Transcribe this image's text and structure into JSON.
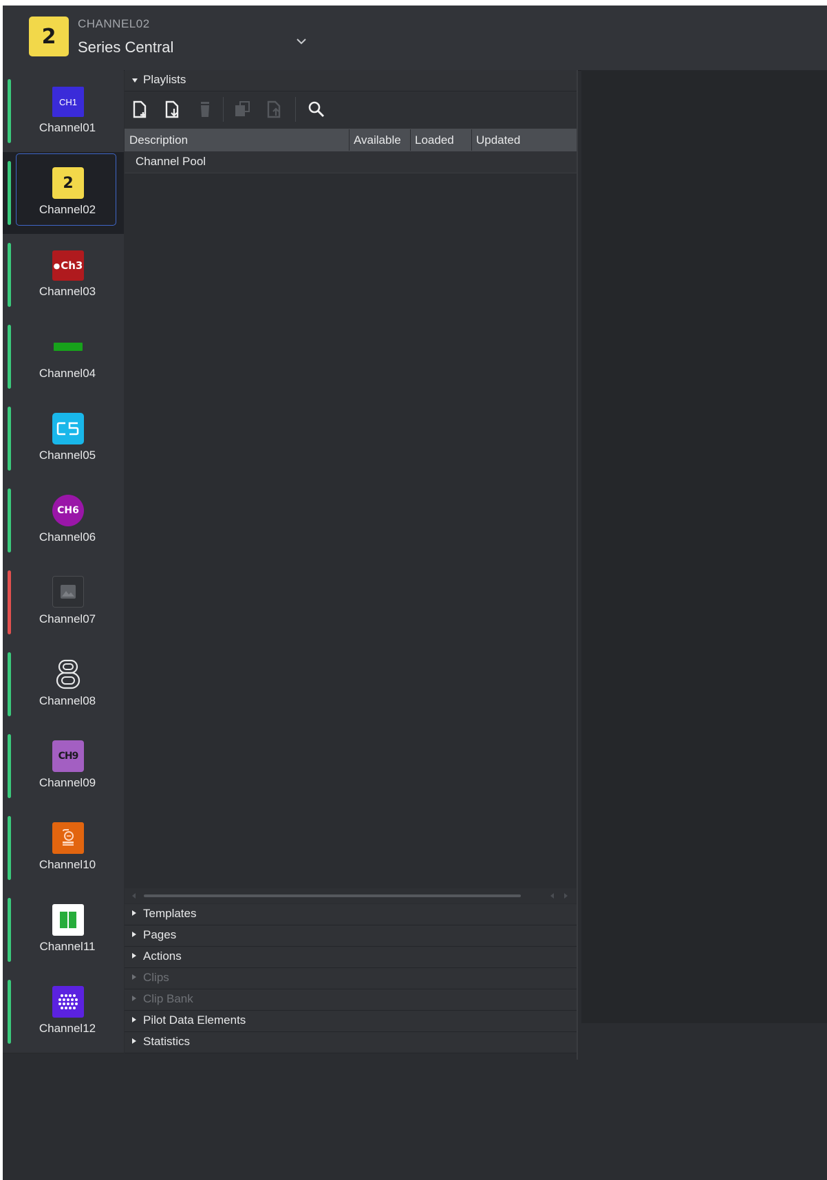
{
  "header": {
    "logo_text": "2",
    "channel_code": "CHANNEL02",
    "title": "Series Central",
    "dropdown_icon": "chevron-down-icon"
  },
  "sidebar": {
    "channels": [
      {
        "label": "Channel01",
        "logo_text": "CH1",
        "status": "green"
      },
      {
        "label": "Channel02",
        "logo_text": "2",
        "status": "green",
        "selected": true
      },
      {
        "label": "Channel03",
        "logo_text": "Ch3",
        "status": "green"
      },
      {
        "label": "Channel04",
        "logo_text": "",
        "status": "green"
      },
      {
        "label": "Channel05",
        "logo_text": "C5",
        "status": "green"
      },
      {
        "label": "Channel06",
        "logo_text": "CH6",
        "status": "green"
      },
      {
        "label": "Channel07",
        "logo_text": "",
        "status": "red"
      },
      {
        "label": "Channel08",
        "logo_text": "",
        "status": "green"
      },
      {
        "label": "Channel09",
        "logo_text": "CH9",
        "status": "green"
      },
      {
        "label": "Channel10",
        "logo_text": "",
        "status": "green"
      },
      {
        "label": "Channel11",
        "logo_text": "",
        "status": "green"
      },
      {
        "label": "Channel12",
        "logo_text": "",
        "status": "green"
      }
    ]
  },
  "playlists": {
    "section_label": "Playlists",
    "toolbar": [
      "new-playlist-icon",
      "import-playlist-icon",
      "delete-icon",
      "copy-icon",
      "export-icon",
      "search-icon"
    ],
    "columns": {
      "description": "Description",
      "available": "Available",
      "loaded": "Loaded",
      "updated": "Updated"
    },
    "rows": [
      {
        "description": "Channel Pool"
      }
    ]
  },
  "sections": [
    {
      "label": "Templates",
      "enabled": true
    },
    {
      "label": "Pages",
      "enabled": true
    },
    {
      "label": "Actions",
      "enabled": true
    },
    {
      "label": "Clips",
      "enabled": false
    },
    {
      "label": "Clip Bank",
      "enabled": false
    },
    {
      "label": "Pilot Data Elements",
      "enabled": true
    },
    {
      "label": "Statistics",
      "enabled": true
    }
  ],
  "colors": {
    "status_green": "#3bc97c",
    "status_red": "#e3514f",
    "selection_border": "#3f67c8",
    "channel02_yellow": "#f2d84a"
  }
}
